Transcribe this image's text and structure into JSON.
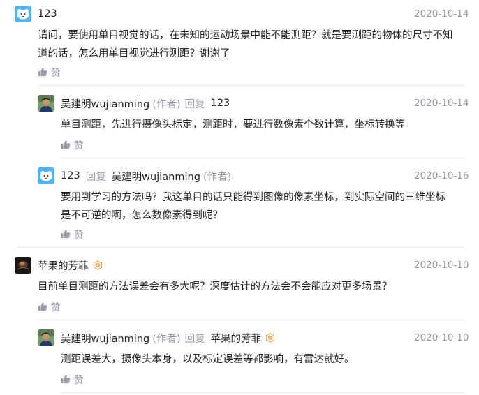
{
  "comments": [
    {
      "username": "123",
      "date": "2020-10-14",
      "text_line1": "请问，要使用单目视觉的话，在未知的运动场景中能不能测距？就是要测距的物体的尺寸不知",
      "text_line2": "道的话，怎么用单目视觉进行测距？谢谢了",
      "like_label": "赞",
      "avatar_icon": "cartoon-avatar-icon",
      "replies": [
        {
          "username": "吴建明wujianming",
          "author_tag": "(作者)",
          "reply_word": "回复",
          "reply_target": "123",
          "date": "2020-10-14",
          "text_line1": "单目测距，先进行摄像头标定，测距时，要进行数像素个数计算，坐标转换等",
          "like_label": "赞",
          "avatar_icon": "photo-avatar-icon"
        },
        {
          "username": "123",
          "reply_word": "回复",
          "reply_target": "吴建明wujianming",
          "reply_target_tag": "(作者)",
          "date": "2020-10-16",
          "text_line1": "要用到学习的方法吗？我这单目的话只能得到图像的像素坐标，到实际空间的三维坐标",
          "text_line2": "是不可逆的啊，怎么数像素得到呢？",
          "like_label": "赞",
          "avatar_icon": "cartoon-avatar-icon"
        }
      ]
    },
    {
      "username": "苹果的芳菲",
      "date": "2020-10-10",
      "text_line1": "目前单目测距的方法误差会有多大呢？深度估计的方法会不会能应对更多场景？",
      "like_label": "赞",
      "avatar_icon": "dark-photo-avatar-icon",
      "badge_icon": "level-badge-icon",
      "replies": [
        {
          "username": "吴建明wujianming",
          "author_tag": "(作者)",
          "reply_word": "回复",
          "reply_target": "苹果的芳菲",
          "date": "2020-10-10",
          "text_line1": "测距误差大，摄像头本身，以及标定误差等都影响，有雷达就好。",
          "like_label": "赞",
          "avatar_icon": "photo-avatar-icon",
          "badge_icon": "level-badge-icon"
        }
      ]
    }
  ],
  "colors": {
    "text": "#222226",
    "muted": "#999aaa",
    "divider": "#ececec",
    "badge": "#e8a65a"
  }
}
